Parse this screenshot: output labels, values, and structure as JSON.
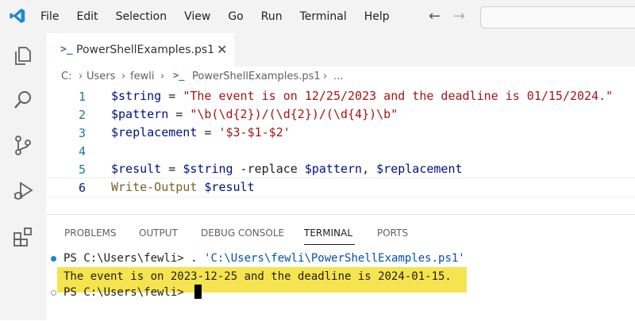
{
  "menu": [
    "File",
    "Edit",
    "Selection",
    "View",
    "Go",
    "Run",
    "Terminal",
    "Help"
  ],
  "tab": {
    "icon": "powershell-icon",
    "name": "PowerShellExamples.ps1"
  },
  "breadcrumb": {
    "c": "C:",
    "users": "Users",
    "user": "fewli",
    "file": "PowerShellExamples.ps1",
    "more": "..."
  },
  "editor": {
    "lines": [
      {
        "n": "1",
        "var": "$string",
        "op": " = ",
        "val": "\"The event is on 12/25/2023 and the deadline is 01/15/2024.\""
      },
      {
        "n": "2",
        "var": "$pattern",
        "op": " = ",
        "val": "\"\\b(\\d{2})/(\\d{2})/(\\d{4})\\b\""
      },
      {
        "n": "3",
        "var": "$replacement",
        "op": " = ",
        "val": "'$3-$1-$2'"
      },
      {
        "n": "4"
      },
      {
        "n": "5",
        "var": "$result",
        "op": " = ",
        "var2": "$string",
        "op2": " -replace ",
        "var3": "$pattern",
        "op3": ", ",
        "var4": "$replacement"
      },
      {
        "n": "6",
        "cmdlet": "Write-Output",
        "op": " ",
        "var": "$result"
      }
    ]
  },
  "panel_tabs": [
    "PROBLEMS",
    "OUTPUT",
    "DEBUG CONSOLE",
    "TERMINAL",
    "PORTS"
  ],
  "panel_active": "TERMINAL",
  "terminal": {
    "prompt1": "PS C:\\Users\\fewli> ",
    "command_dot": ". ",
    "command_path": "'C:\\Users\\fewli\\PowerShellExamples.ps1'",
    "output": "The event is on 2023-12-25 and the deadline is 2024-01-15.",
    "prompt2": "PS C:\\Users\\fewli> "
  },
  "colors": {
    "highlight": "#f5e44f",
    "accent": "#007acc",
    "string": "#a31515",
    "variable": "#001080"
  }
}
